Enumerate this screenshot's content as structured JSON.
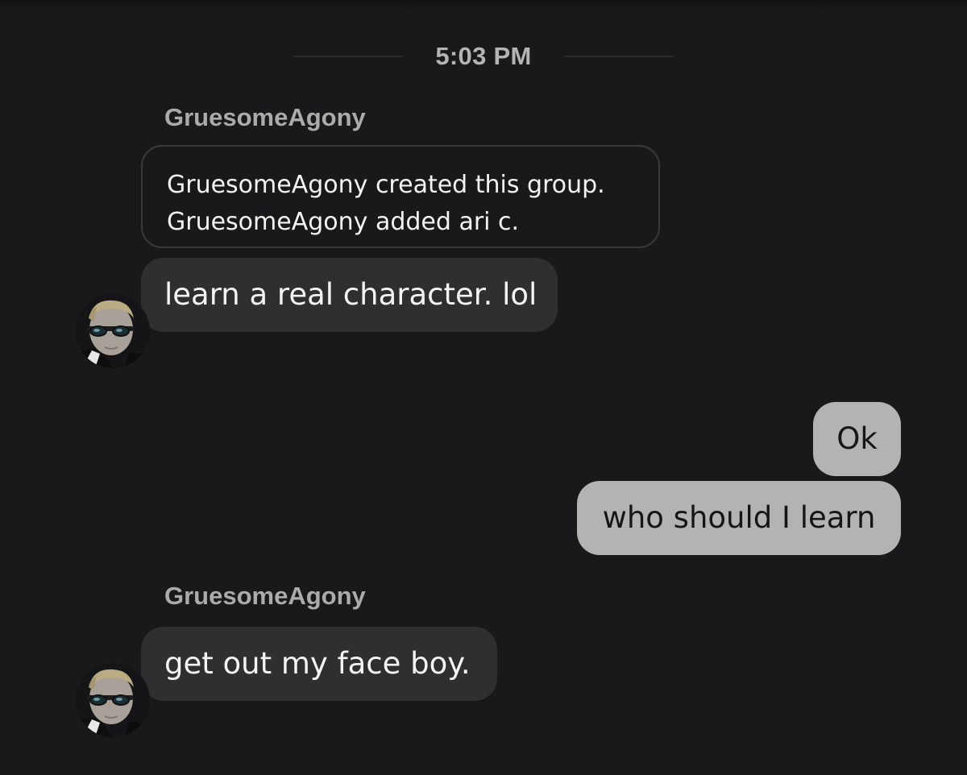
{
  "timestamp": "5:03 PM",
  "messages": [
    {
      "sender": "GruesomeAgony",
      "system_lines": [
        "GruesomeAgony created this group.",
        "GruesomeAgony added ari c."
      ],
      "text": "learn a real character. lol"
    },
    {
      "outgoing": [
        "Ok",
        "who should I learn"
      ]
    },
    {
      "sender": "GruesomeAgony",
      "text": "get out my face boy."
    }
  ],
  "colors": {
    "background": "#19191b",
    "incoming_bubble": "#2f2f32",
    "outgoing_bubble": "#b3b3b3",
    "sender_name": "#ababab",
    "timestamp": "#b4b4b4"
  },
  "icons": {
    "avatar": "user-avatar-icon"
  }
}
